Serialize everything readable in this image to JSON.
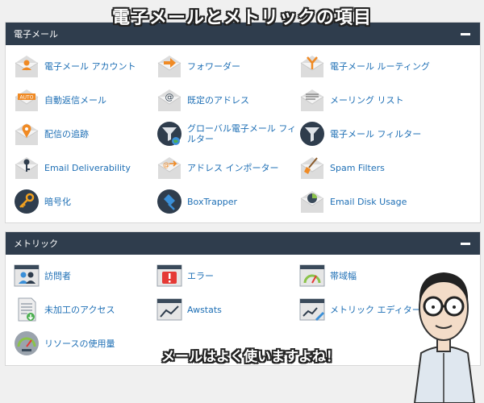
{
  "banner": "電子メールとメトリックの項目",
  "email_section": {
    "title": "電子メール",
    "items": [
      {
        "label": "電子メール アカウント",
        "icon": "person-envelope-icon"
      },
      {
        "label": "フォワーダー",
        "icon": "forward-arrow-envelope-icon"
      },
      {
        "label": "電子メール ルーティング",
        "icon": "routing-envelope-icon"
      },
      {
        "label": "自動返信メール",
        "icon": "auto-reply-envelope-icon"
      },
      {
        "label": "既定のアドレス",
        "icon": "at-sign-envelope-icon"
      },
      {
        "label": "メーリング リスト",
        "icon": "mailing-list-envelope-icon"
      },
      {
        "label": "配信の追跡",
        "icon": "location-pin-envelope-icon"
      },
      {
        "label": "グローバル電子メール フィルター",
        "icon": "globe-filter-icon"
      },
      {
        "label": "電子メール フィルター",
        "icon": "funnel-filter-icon"
      },
      {
        "label": "Email Deliverability",
        "icon": "key-envelope-icon"
      },
      {
        "label": "アドレス インポーター",
        "icon": "import-envelope-icon"
      },
      {
        "label": "Spam Filters",
        "icon": "spam-brush-envelope-icon"
      },
      {
        "label": "暗号化",
        "icon": "encryption-key-icon"
      },
      {
        "label": "BoxTrapper",
        "icon": "boxtrapper-icon"
      },
      {
        "label": "Email Disk Usage",
        "icon": "pie-chart-envelope-icon"
      }
    ]
  },
  "metrics_section": {
    "title": "メトリック",
    "items": [
      {
        "label": "訪問者",
        "icon": "visitors-icon"
      },
      {
        "label": "エラー",
        "icon": "error-icon"
      },
      {
        "label": "帯域幅",
        "icon": "bandwidth-gauge-icon"
      },
      {
        "label": "未加工のアクセス",
        "icon": "raw-access-document-icon"
      },
      {
        "label": "Awstats",
        "icon": "awstats-line-chart-icon"
      },
      {
        "label": "メトリック エディター",
        "icon": "metrics-editor-icon"
      },
      {
        "label": "リソースの使用量",
        "icon": "resource-usage-gauge-icon"
      }
    ]
  },
  "caption": "メールはよく使いますよね！",
  "colors": {
    "header_bg": "#2f3d4d",
    "link": "#1e6fb5",
    "accent": "#f08a24"
  }
}
